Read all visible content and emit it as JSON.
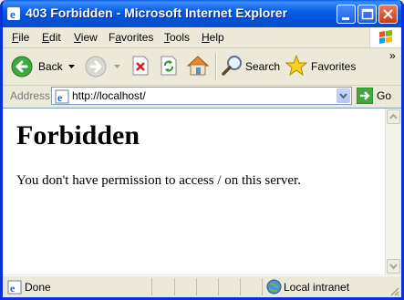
{
  "window": {
    "title": "403 Forbidden - Microsoft Internet Explorer"
  },
  "menu": {
    "file": "File",
    "file_key": "F",
    "file_rest": "ile",
    "edit": "Edit",
    "edit_key": "E",
    "edit_rest": "dit",
    "view": "View",
    "view_key": "V",
    "view_rest": "iew",
    "favorites": "Favorites",
    "favorites_key": "a",
    "favorites_pre": "F",
    "favorites_rest": "vorites",
    "tools": "Tools",
    "tools_key": "T",
    "tools_rest": "ools",
    "help": "Help",
    "help_key": "H",
    "help_rest": "elp"
  },
  "toolbar": {
    "back_label": "Back",
    "search_label": "Search",
    "favorites_label": "Favorites",
    "overflow": "»"
  },
  "address": {
    "label": "Address",
    "url": "http://localhost/",
    "go_label": "Go"
  },
  "page": {
    "heading": "Forbidden",
    "message": "You don't have permission to access / on this server."
  },
  "status": {
    "text": "Done",
    "zone": "Local intranet"
  }
}
